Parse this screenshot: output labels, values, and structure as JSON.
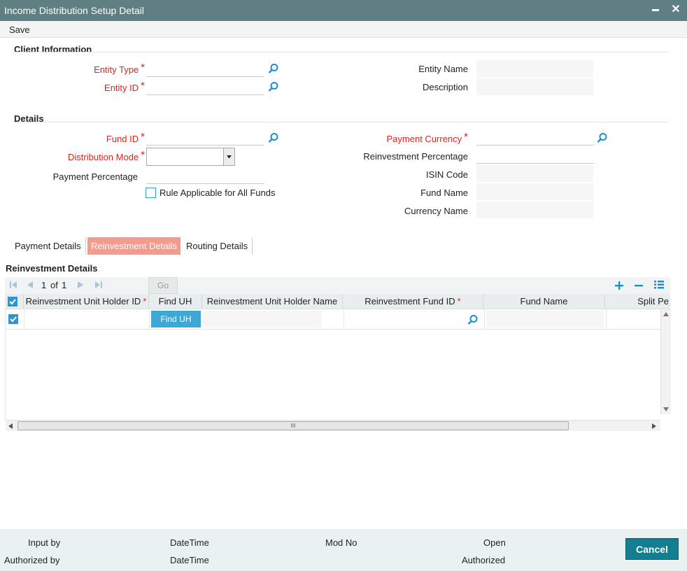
{
  "window": {
    "title": "Income Distribution Setup Detail",
    "minimize_glyph": "▬",
    "close_glyph": "✕"
  },
  "menu": {
    "save": "Save"
  },
  "client_info": {
    "title": "Client Information",
    "entity_type": {
      "label": "Entity Type",
      "value": ""
    },
    "entity_id": {
      "label": "Entity ID",
      "value": ""
    },
    "entity_name": {
      "label": "Entity Name",
      "value": ""
    },
    "description": {
      "label": "Description",
      "value": ""
    }
  },
  "details": {
    "title": "Details",
    "fund_id": {
      "label": "Fund ID",
      "value": ""
    },
    "distribution_mode": {
      "label": "Distribution Mode",
      "value": ""
    },
    "payment_percentage": {
      "label": "Payment Percentage",
      "value": ""
    },
    "rule_all_funds": {
      "label": "Rule Applicable for All Funds",
      "checked": false
    },
    "payment_currency": {
      "label": "Payment Currency",
      "value": ""
    },
    "reinvestment_percentage": {
      "label": "Reinvestment Percentage",
      "value": ""
    },
    "isin_code": {
      "label": "ISIN Code",
      "value": ""
    },
    "fund_name": {
      "label": "Fund Name",
      "value": ""
    },
    "currency_name": {
      "label": "Currency Name",
      "value": ""
    }
  },
  "tabs": [
    {
      "label": "Payment Details",
      "active": false
    },
    {
      "label": "Reinvestment Details",
      "active": true
    },
    {
      "label": "Routing Details",
      "active": false
    }
  ],
  "grid": {
    "title": "Reinvestment Details",
    "pager": {
      "current": "1",
      "of_label": "of",
      "total": "1",
      "go": "Go"
    },
    "columns": [
      "Reinvestment Unit Holder ID",
      "Find UH",
      "Reinvestment Unit Holder Name",
      "Reinvestment Fund ID",
      "Fund Name",
      "Split Pe"
    ],
    "required_columns": [
      0,
      3
    ],
    "row": {
      "selected": true,
      "find_button": "Find UH",
      "unit_holder_id": "",
      "unit_holder_name": "",
      "fund_id": "",
      "fund_name": ""
    },
    "scroll_marker": "III"
  },
  "footer": {
    "input_by": "Input by",
    "authorized_by": "Authorized by",
    "datetime1": "DateTime",
    "datetime2": "DateTime",
    "mod_no": "Mod No",
    "open": "Open",
    "authorized": "Authorized",
    "cancel": "Cancel"
  },
  "colors": {
    "title_bar": "#5f7f83",
    "accent_blue": "#2b97cf",
    "required_red": "#d7261b",
    "active_tab": "#f29b8f",
    "cancel_button": "#137e8f"
  }
}
